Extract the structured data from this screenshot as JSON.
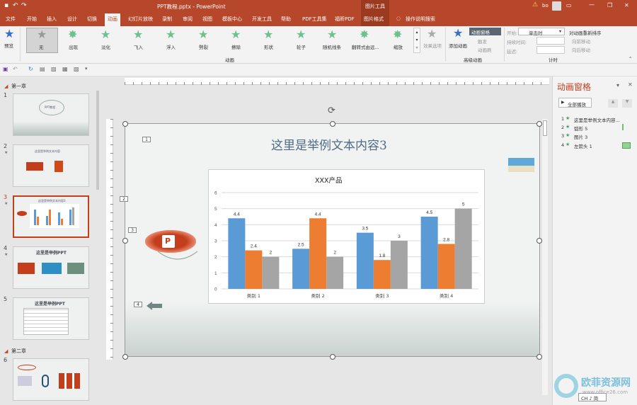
{
  "window": {
    "title": "PPT教程.pptx - PowerPoint",
    "context_tool": "图片工具",
    "user": "bo",
    "minimize": "—",
    "restore": "❐",
    "close": "✕"
  },
  "tabs": [
    "文件",
    "开始",
    "插入",
    "设计",
    "切换",
    "动画",
    "幻灯片放映",
    "录制",
    "审阅",
    "视图",
    "模板中心",
    "开发工具",
    "帮助",
    "PDF工具集",
    "福昕PDF",
    "图片格式",
    "操作说明搜索"
  ],
  "ribbon": {
    "preview": "预览",
    "effects": [
      "无",
      "出现",
      "淡化",
      "飞入",
      "浮入",
      "劈裂",
      "擦除",
      "形状",
      "轮子",
      "随机线条",
      "翻转式由远...",
      "缩放"
    ],
    "effect_options": "效果选项",
    "add_animation": "添加动画",
    "anim_pane_btn": "动画窗格",
    "trigger": "触发",
    "anim_painter": "动画刷",
    "start_label": "开始:",
    "start_value": "单击时",
    "duration_label": "持续时间:",
    "delay_label": "延迟:",
    "reorder": "对动画重新排序",
    "move_earlier": "向前移动",
    "move_later": "向后移动",
    "group_anim": "动画",
    "group_adv": "高级动画",
    "group_timing": "计时"
  },
  "sections": {
    "ch1": "第一章",
    "ch2": "第二章"
  },
  "thumbs": {
    "t1": "PPT教程",
    "t2": "这里是举例文本内容",
    "t3": "这里是举例文本内容3",
    "t4": "这里是举例PPT",
    "t5": "这里是举例PPT"
  },
  "slide_nums": [
    "1",
    "2",
    "3",
    "4",
    "5",
    "6"
  ],
  "slide": {
    "title": "这里是举例文本内容3",
    "tags": [
      "1",
      "2",
      "3",
      "4"
    ],
    "logo_text": "P"
  },
  "chart_data": {
    "type": "bar",
    "title": "XXX产品",
    "categories": [
      "类别 1",
      "类别 2",
      "类别 3",
      "类别 4"
    ],
    "series": [
      {
        "values": [
          4.4,
          2.5,
          3.5,
          4.5
        ],
        "color": "#5b9bd5"
      },
      {
        "values": [
          2.4,
          4.4,
          1.8,
          2.8
        ],
        "color": "#ed7d31"
      },
      {
        "values": [
          2,
          2,
          3,
          5
        ],
        "color": "#a5a5a5"
      }
    ],
    "ylim": [
      0,
      6
    ],
    "yticks": [
      "0",
      "1",
      "2",
      "3",
      "4",
      "5",
      "6"
    ],
    "grid": true
  },
  "anim_pane": {
    "title": "动画窗格",
    "play_all": "全部播放",
    "items": [
      {
        "num": "1",
        "name": "这里是举例文本内容..."
      },
      {
        "num": "2",
        "name": "弧形 5"
      },
      {
        "num": "3",
        "name": "图片 3"
      },
      {
        "num": "4",
        "name": "左箭头 1"
      }
    ]
  },
  "status": {
    "ime": "CH ♪ 简"
  },
  "watermark": {
    "text": "欧菲资源网",
    "url": "www.office26.com"
  }
}
